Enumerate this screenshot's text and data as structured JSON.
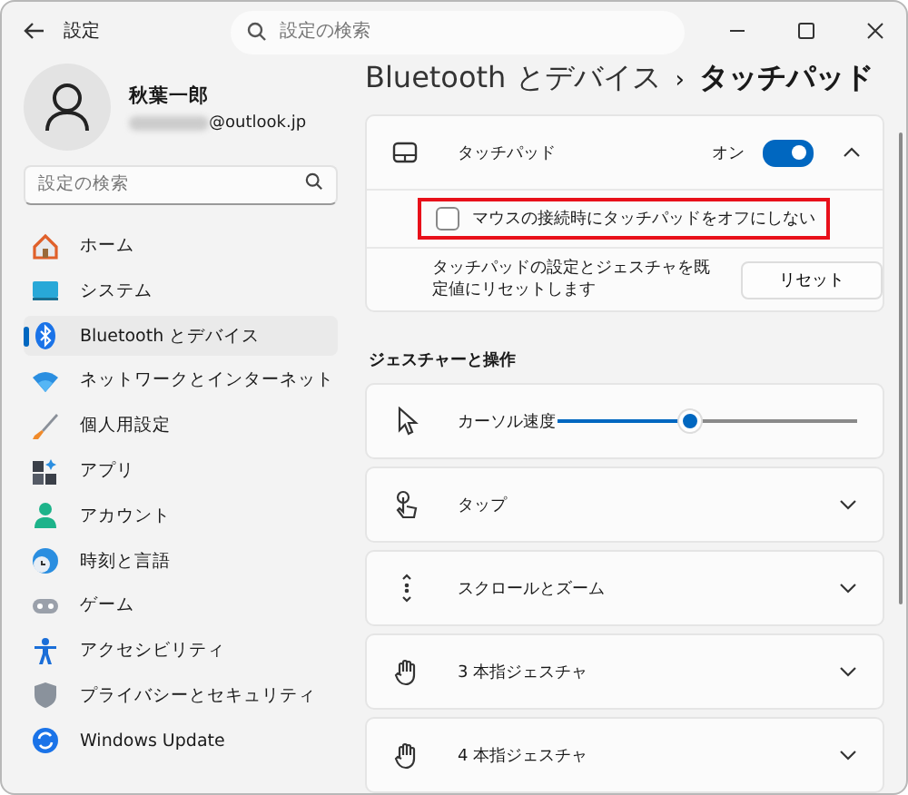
{
  "window": {
    "title": "設定",
    "search": {
      "placeholder": "設定の検索"
    }
  },
  "user": {
    "name": "秋葉一郎",
    "email": "@outlook.jp"
  },
  "sidebar": {
    "search": {
      "placeholder": "設定の検索"
    },
    "items": [
      {
        "kind": "home",
        "label": "ホーム",
        "selected": false
      },
      {
        "kind": "system",
        "label": "システム",
        "selected": false
      },
      {
        "kind": "bluetooth",
        "label": "Bluetooth とデバイス",
        "selected": true
      },
      {
        "kind": "network",
        "label": "ネットワークとインターネット",
        "selected": false
      },
      {
        "kind": "brush",
        "label": "個人用設定",
        "selected": false
      },
      {
        "kind": "apps",
        "label": "アプリ",
        "selected": false
      },
      {
        "kind": "account",
        "label": "アカウント",
        "selected": false
      },
      {
        "kind": "time",
        "label": "時刻と言語",
        "selected": false
      },
      {
        "kind": "game",
        "label": "ゲーム",
        "selected": false
      },
      {
        "kind": "accessibility",
        "label": "アクセシビリティ",
        "selected": false
      },
      {
        "kind": "shield",
        "label": "プライバシーとセキュリティ",
        "selected": false
      },
      {
        "kind": "update",
        "label": "Windows Update",
        "selected": false
      }
    ]
  },
  "breadcrumb": {
    "parent": "Bluetooth とデバイス",
    "separator": "›",
    "current": "タッチパッド"
  },
  "touchpad": {
    "label": "タッチパッド",
    "state_label": "オン",
    "on": true,
    "expanded": true,
    "option": {
      "label": "マウスの接続時にタッチパッドをオフにしない",
      "checked": false,
      "highlighted": true
    },
    "reset": {
      "description": "タッチパッドの設定とジェスチャを既定値にリセットします",
      "button": "リセット"
    }
  },
  "gestures": {
    "heading": "ジェスチャーと操作",
    "items": [
      {
        "kind": "slider",
        "label": "カーソル速度",
        "level": 0.44
      },
      {
        "kind": "expander",
        "label": "タップ",
        "expanded": false
      },
      {
        "kind": "expander",
        "label": "スクロールとズーム",
        "expanded": false
      },
      {
        "kind": "expander",
        "label": "3 本指ジェスチャ",
        "expanded": false
      },
      {
        "kind": "expander",
        "label": "4 本指ジェスチャ",
        "expanded": false
      }
    ]
  }
}
